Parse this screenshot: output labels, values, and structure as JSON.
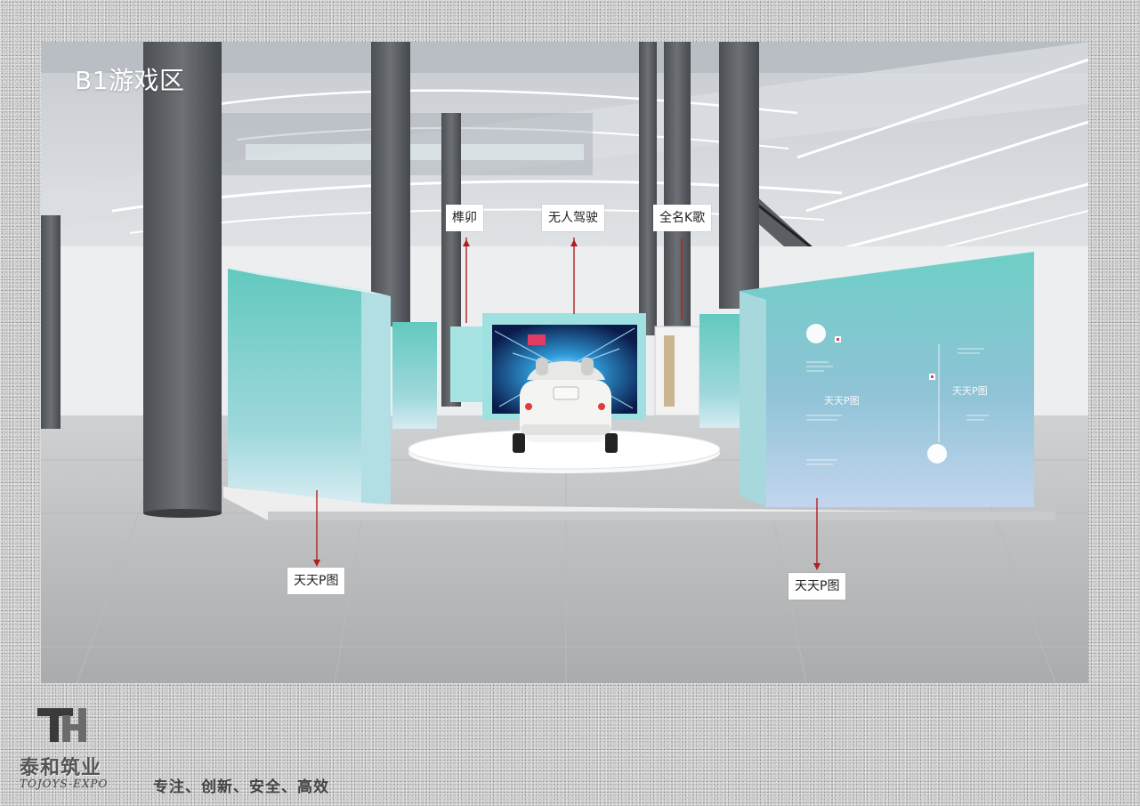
{
  "page": {
    "area_title": "B1游戏区"
  },
  "callouts": {
    "sunmao": "榫卯",
    "driverless": "无人驾驶",
    "karaoke": "全名K歌",
    "ptu_left": "天天P图",
    "ptu_right": "天天P图"
  },
  "panel": {
    "title": "天天P图"
  },
  "brand": {
    "name": "泰和筑业",
    "name_en": "TOJOYS-EXPO",
    "slogan": "专注、创新、安全、高效"
  },
  "colors": {
    "teal": "#6ed1c9",
    "arrow_red": "#b02020"
  }
}
